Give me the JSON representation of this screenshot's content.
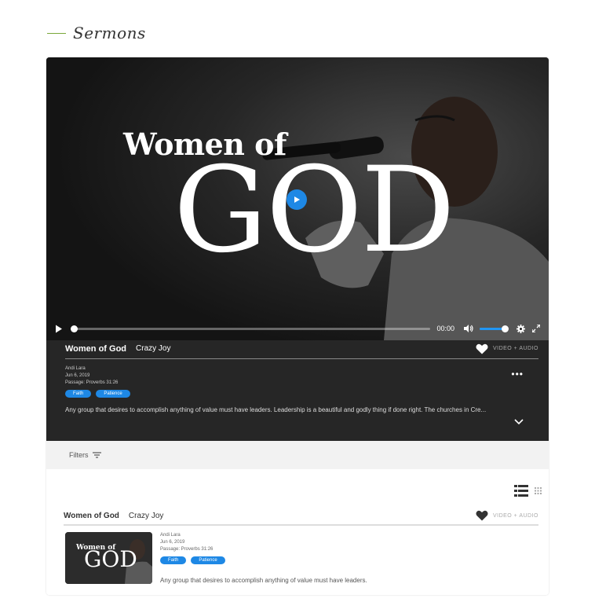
{
  "page": {
    "section_title": "Sermons"
  },
  "video": {
    "title_line1": "Women of",
    "title_line2": "GOD",
    "time": "00:00",
    "progress": 0,
    "volume": 0.9
  },
  "sermon": {
    "title": "Women of God",
    "series": "Crazy Joy",
    "media_type": "VIDEO + AUDIO",
    "speaker": "Andi Lara",
    "date": "Jun 6, 2019",
    "passage": "Passage: Proverbs 31:26",
    "tags": [
      "Faith",
      "Patience"
    ],
    "description": "Any group that desires to accomplish anything of value must have leaders. Leadership is a beautiful and godly thing if done right. The churches in Cre...",
    "more": "•••"
  },
  "filters": {
    "label": "Filters"
  },
  "list": {
    "item": {
      "title": "Women of God",
      "series": "Crazy Joy",
      "media_type": "VIDEO + AUDIO",
      "speaker": "Andi Lara",
      "date": "Jun 6, 2019",
      "passage": "Passage: Proverbs 31:26",
      "tags": [
        "Faith",
        "Patience"
      ],
      "thumb_line1": "Women of",
      "thumb_line2": "GOD",
      "description": "Any group that desires to accomplish anything of value must have leaders."
    }
  },
  "colors": {
    "accent": "#1e88e5",
    "header_line": "#7aa83a",
    "info_bg": "#262626"
  },
  "icons": [
    "play-icon",
    "volume-icon",
    "settings-icon",
    "fullscreen-icon",
    "heart-icon",
    "chevron-down-icon",
    "filter-icon",
    "list-view-icon",
    "grid-view-icon"
  ]
}
